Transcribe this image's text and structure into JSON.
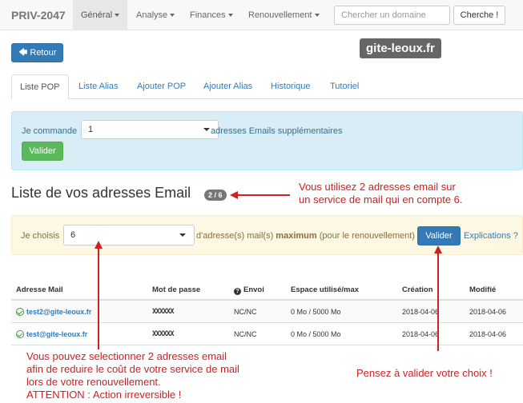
{
  "navbar": {
    "brand": "PRIV-2047",
    "items": [
      {
        "label": "Général",
        "active": true
      },
      {
        "label": "Analyse",
        "active": false
      },
      {
        "label": "Finances",
        "active": false
      },
      {
        "label": "Renouvellement",
        "active": false
      }
    ],
    "search_placeholder": "Chercher un domaine",
    "search_button": "Cherche !"
  },
  "back_button": "Retour",
  "domain": "gite-leoux.fr",
  "tabs": [
    {
      "label": "Liste POP",
      "active": true
    },
    {
      "label": "Liste Alias",
      "active": false
    },
    {
      "label": "Ajouter POP",
      "active": false
    },
    {
      "label": "Ajouter Alias",
      "active": false
    },
    {
      "label": "Historique",
      "active": false
    },
    {
      "label": "Tutoriel",
      "active": false
    }
  ],
  "order": {
    "label": "Je commande",
    "value": "1",
    "suffix": "adresses Emails supplémentaires",
    "button": "Valider"
  },
  "list": {
    "title": "Liste de vos adresses Email",
    "badge": "2 / 6"
  },
  "choose": {
    "label": "Je choisis",
    "value": "6",
    "suffix_before": "d'adresse(s) mail(s)",
    "suffix_bold": "maximum",
    "suffix_after": "(pour le renouvellement)",
    "button": "Valider",
    "link": "Explications ?"
  },
  "table": {
    "headers": {
      "email": "Adresse Mail",
      "password": "Mot de passe",
      "envoi": "Envoi",
      "espace": "Espace utilisé/max",
      "creation": "Création",
      "modifie": "Modifié"
    },
    "rows": [
      {
        "email": "test2@gite-leoux.fr",
        "password": "XXXXXX",
        "envoi": "NC/NC",
        "espace": "0 Mo / 5000 Mo",
        "creation": "2018-04-06",
        "modifie": "2018-04-06"
      },
      {
        "email": "test@gite-leoux.fr",
        "password": "XXXXXX",
        "envoi": "NC/NC",
        "espace": "0 Mo / 5000 Mo",
        "creation": "2018-04-06",
        "modifie": "2018-04-06"
      }
    ]
  },
  "annotations": {
    "usage": [
      "Vous utilisez 2 adresses email sur",
      "un service de mail qui en compte 6."
    ],
    "select": [
      "Vous pouvez selectionner 2 adresses email",
      "afin de reduire le coût de votre service de mail",
      "lors de votre renouvellement.",
      "ATTENTION : Action irreversible !"
    ],
    "validate": "Pensez à  valider votre choix !"
  },
  "colors": {
    "primary": "#337ab7",
    "success": "#5cb85c",
    "info_bg": "#d9edf7",
    "warning_bg": "#fcf8e3",
    "annotation": "#cc2222"
  }
}
